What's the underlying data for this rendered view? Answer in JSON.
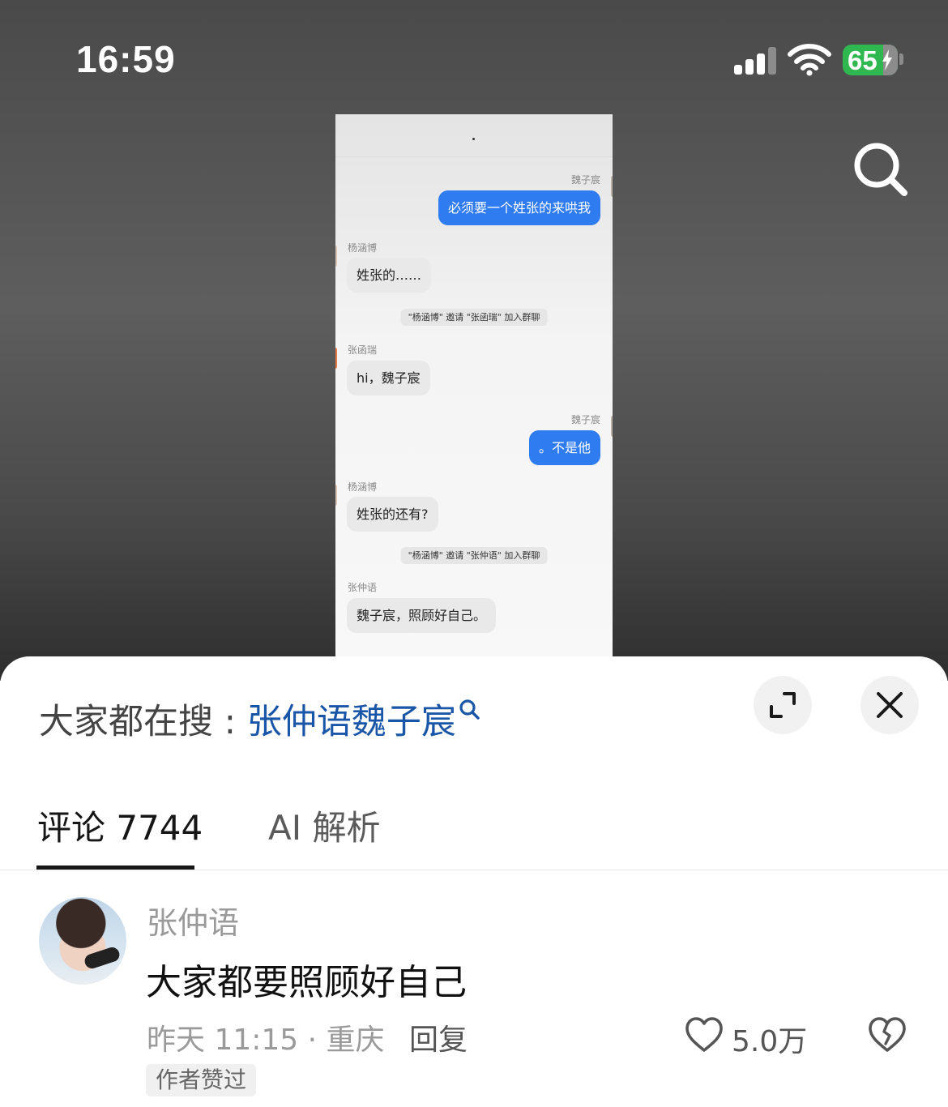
{
  "status_bar": {
    "time": "16:59",
    "battery_level": "65",
    "icons": [
      "cellular-signal-icon",
      "wifi-icon",
      "battery-charging-icon"
    ]
  },
  "video": {
    "search_icon": "search-icon",
    "chat_screenshot": {
      "messages": [
        {
          "kind": "outgoing",
          "sender": "魏子宸",
          "text": "必须要一个姓张的来哄我"
        },
        {
          "kind": "incoming",
          "sender": "杨涵博",
          "text": "姓张的……"
        },
        {
          "kind": "system",
          "text": "\"杨涵博\" 邀请 \"张函瑞\" 加入群聊"
        },
        {
          "kind": "incoming",
          "sender": "张函瑞",
          "text": "hi，魏子宸"
        },
        {
          "kind": "outgoing",
          "sender": "魏子宸",
          "text": "。不是他"
        },
        {
          "kind": "incoming",
          "sender": "杨涵博",
          "text": "姓张的还有?"
        },
        {
          "kind": "system",
          "text": "\"杨涵博\" 邀请 \"张仲语\" 加入群聊"
        },
        {
          "kind": "incoming",
          "sender": "张仲语",
          "text": "魏子宸，照顾好自己。"
        }
      ]
    }
  },
  "sheet": {
    "hot_search_prefix": "大家都在搜 : ",
    "hot_search_keyword": "张仲语魏子宸",
    "expand_icon": "expand-icon",
    "close_icon": "close-icon",
    "tabs": [
      {
        "label": "评论 7744",
        "active": true
      },
      {
        "label": "AI 解析",
        "active": false
      }
    ],
    "comment": {
      "author": "张仲语",
      "text": "大家都要照顾好自己",
      "meta": "昨天 11:15 · 重庆",
      "reply_label": "回复",
      "like_count": "5.0万",
      "badge": "作者赞过"
    }
  },
  "colors": {
    "keyword_blue": "#1a56a8",
    "bubble_blue": "#2f7bf0",
    "battery_green": "#2fb84f"
  }
}
